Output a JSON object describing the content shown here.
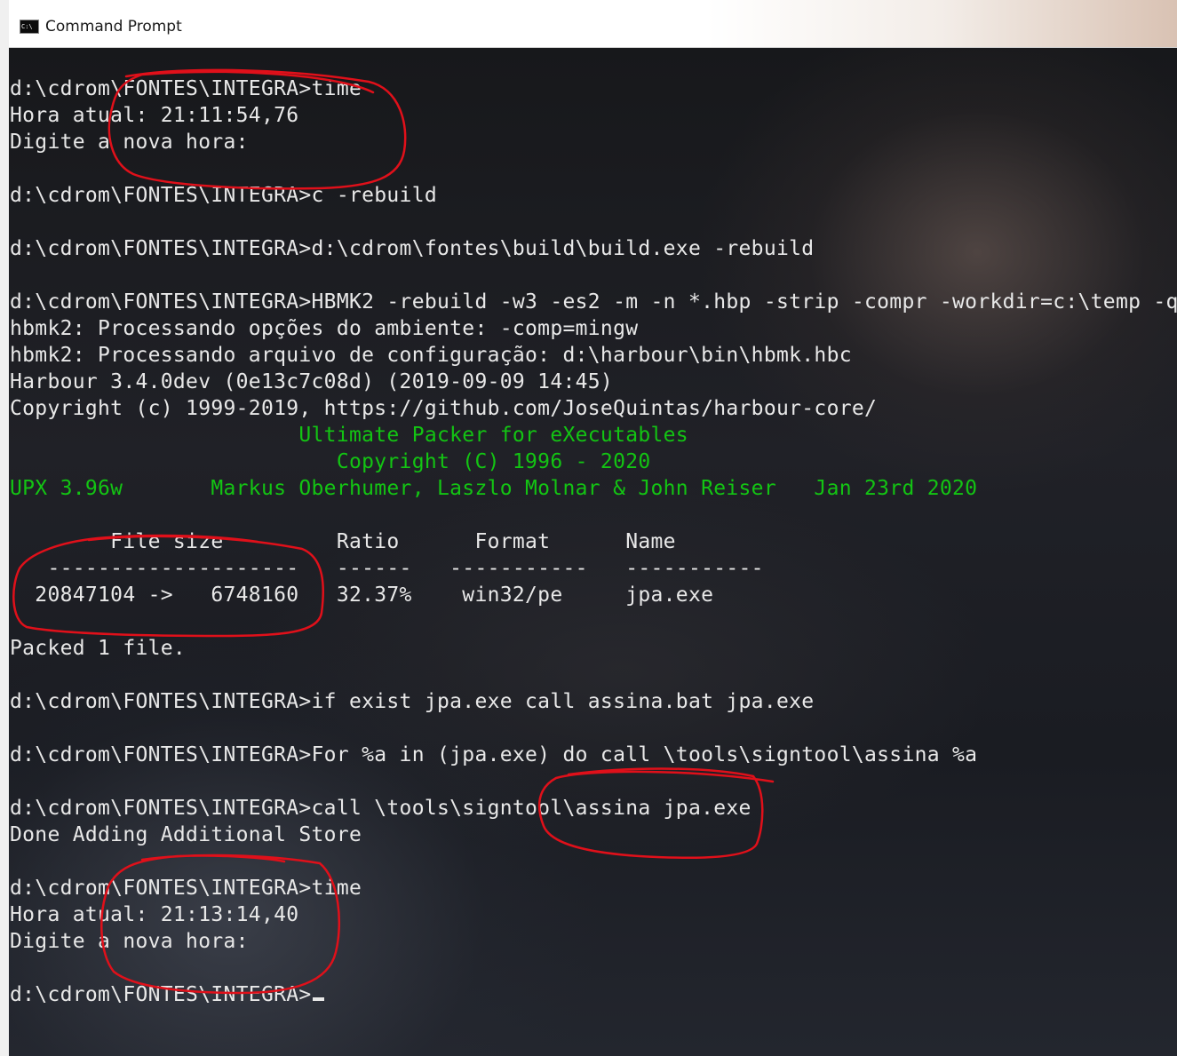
{
  "window": {
    "title": "Command Prompt",
    "icon": "cmd-icon",
    "icon_text": "C:\\"
  },
  "console": {
    "lines": [
      {
        "text": "d:\\cdrom\\FONTES\\INTEGRA>time",
        "color": "#e8e8e8"
      },
      {
        "text": "Hora atual: 21:11:54,76",
        "color": "#e8e8e8"
      },
      {
        "text": "Digite a nova hora:",
        "color": "#e8e8e8"
      },
      {
        "text": "",
        "color": "#e8e8e8"
      },
      {
        "text": "d:\\cdrom\\FONTES\\INTEGRA>c -rebuild",
        "color": "#e8e8e8"
      },
      {
        "text": "",
        "color": "#e8e8e8"
      },
      {
        "text": "d:\\cdrom\\FONTES\\INTEGRA>d:\\cdrom\\fontes\\build\\build.exe -rebuild",
        "color": "#e8e8e8"
      },
      {
        "text": "",
        "color": "#e8e8e8"
      },
      {
        "text": "d:\\cdrom\\FONTES\\INTEGRA>HBMK2 -rebuild -w3 -es2 -m -n *.hbp -strip -compr -workdir=c:\\temp -q",
        "color": "#e8e8e8"
      },
      {
        "text": "hbmk2: Processando opções do ambiente: -comp=mingw",
        "color": "#e8e8e8"
      },
      {
        "text": "hbmk2: Processando arquivo de configuração: d:\\harbour\\bin\\hbmk.hbc",
        "color": "#e8e8e8"
      },
      {
        "text": "Harbour 3.4.0dev (0e13c7c08d) (2019-09-09 14:45)",
        "color": "#e8e8e8"
      },
      {
        "text": "Copyright (c) 1999-2019, https://github.com/JoseQuintas/harbour-core/",
        "color": "#e8e8e8"
      },
      {
        "text": "                       Ultimate Packer for eXecutables",
        "color": "#13c413"
      },
      {
        "text": "                          Copyright (C) 1996 - 2020",
        "color": "#13c413"
      },
      {
        "text": "UPX 3.96w       Markus Oberhumer, Laszlo Molnar & John Reiser   Jan 23rd 2020",
        "color": "#13c413"
      },
      {
        "text": "",
        "color": "#e8e8e8"
      },
      {
        "text": "        File size         Ratio      Format      Name",
        "color": "#e8e8e8"
      },
      {
        "text": "   --------------------   ------   -----------   -----------",
        "color": "#e8e8e8"
      },
      {
        "text": "  20847104 ->   6748160   32.37%    win32/pe     jpa.exe",
        "color": "#e8e8e8"
      },
      {
        "text": "",
        "color": "#e8e8e8"
      },
      {
        "text": "Packed 1 file.",
        "color": "#e8e8e8"
      },
      {
        "text": "",
        "color": "#e8e8e8"
      },
      {
        "text": "d:\\cdrom\\FONTES\\INTEGRA>if exist jpa.exe call assina.bat jpa.exe",
        "color": "#e8e8e8"
      },
      {
        "text": "",
        "color": "#e8e8e8"
      },
      {
        "text": "d:\\cdrom\\FONTES\\INTEGRA>For %a in (jpa.exe) do call \\tools\\signtool\\assina %a",
        "color": "#e8e8e8"
      },
      {
        "text": "",
        "color": "#e8e8e8"
      },
      {
        "text": "d:\\cdrom\\FONTES\\INTEGRA>call \\tools\\signtool\\assina jpa.exe",
        "color": "#e8e8e8"
      },
      {
        "text": "Done Adding Additional Store",
        "color": "#e8e8e8"
      },
      {
        "text": "",
        "color": "#e8e8e8"
      },
      {
        "text": "d:\\cdrom\\FONTES\\INTEGRA>time",
        "color": "#e8e8e8"
      },
      {
        "text": "Hora atual: 21:13:14,40",
        "color": "#e8e8e8"
      },
      {
        "text": "Digite a nova hora:",
        "color": "#e8e8e8"
      },
      {
        "text": "",
        "color": "#e8e8e8"
      }
    ],
    "prompt": "d:\\cdrom\\FONTES\\INTEGRA>"
  },
  "annotation_color": "#e0101a"
}
